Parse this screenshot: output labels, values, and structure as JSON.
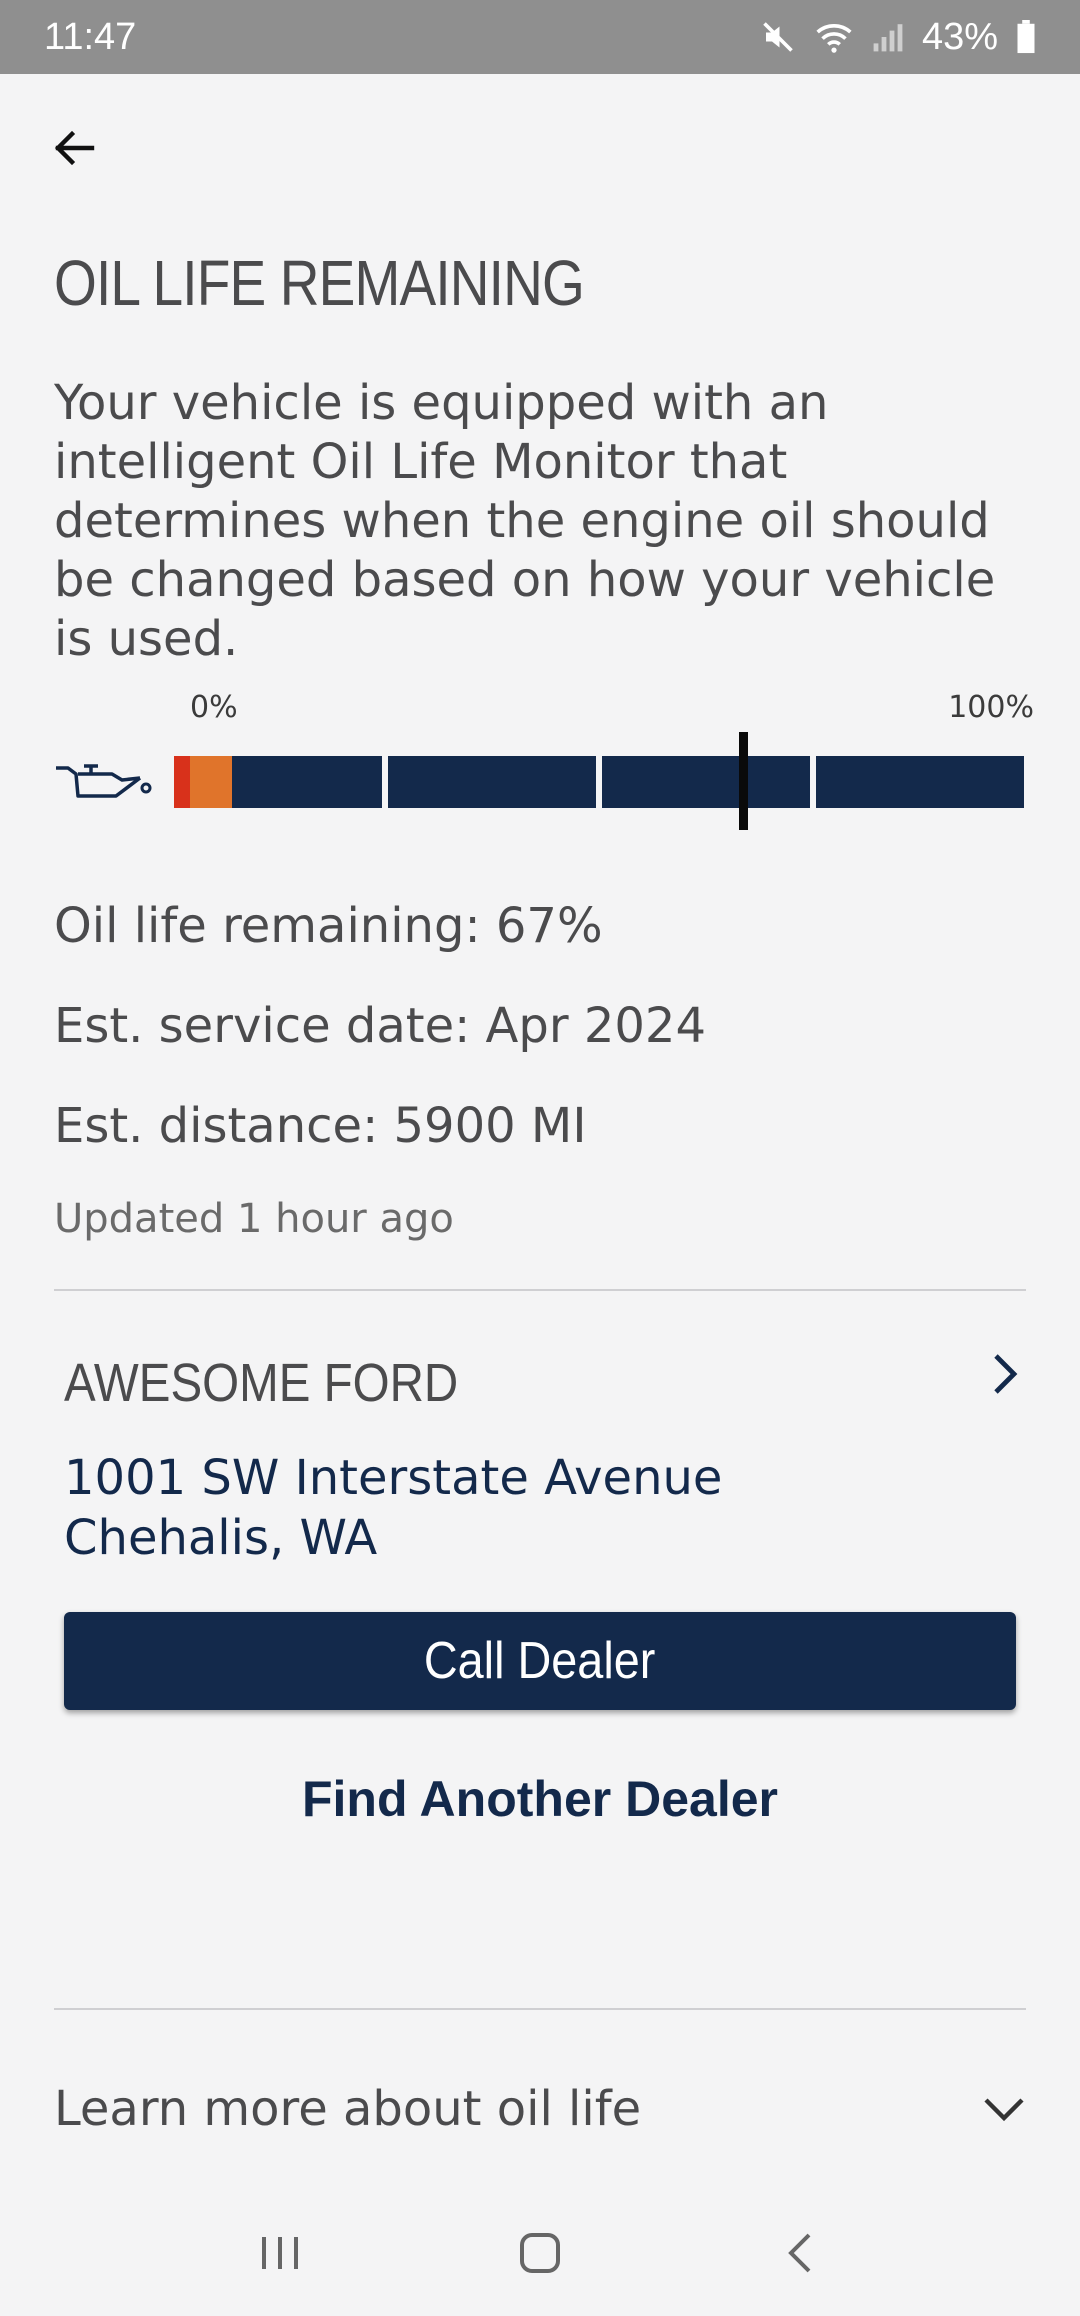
{
  "status_bar": {
    "time": "11:47",
    "battery": "43%",
    "icons": [
      "mute-icon",
      "wifi-icon",
      "signal-icon",
      "battery-icon"
    ]
  },
  "header": {
    "back_icon": "arrow-left-icon",
    "title": "OIL LIFE REMAINING"
  },
  "description": "Your vehicle is equipped with an intelligent Oil Life Monitor that determines when the engine oil should be changed based on how your vehicle is used.",
  "gauge": {
    "label_min": "0%",
    "label_max": "100%",
    "level": 0.67,
    "icon": "oil-can-icon",
    "colors": {
      "critical": "#d8311b",
      "warning": "#e0742b",
      "normal": "#13294b",
      "marker": "#0a0a0a"
    }
  },
  "oil_info": {
    "remaining": "Oil life remaining: 67%",
    "service_date": "Est. service date: Apr 2024",
    "distance": "Est. distance: 5900 MI",
    "updated": "Updated 1 hour ago"
  },
  "dealer": {
    "name": "AWESOME FORD",
    "address_line1": "1001 SW Interstate Avenue",
    "address_line2": "Chehalis, WA",
    "call_label": "Call Dealer",
    "find_label": "Find Another Dealer"
  },
  "learn_more": {
    "label": "Learn more about oil life"
  },
  "nav": {
    "buttons": [
      "recents-icon",
      "home-icon",
      "back-icon"
    ]
  },
  "colors": {
    "brand_navy": "#13294b",
    "background": "#f4f4f5",
    "text": "#4b4b4d"
  }
}
